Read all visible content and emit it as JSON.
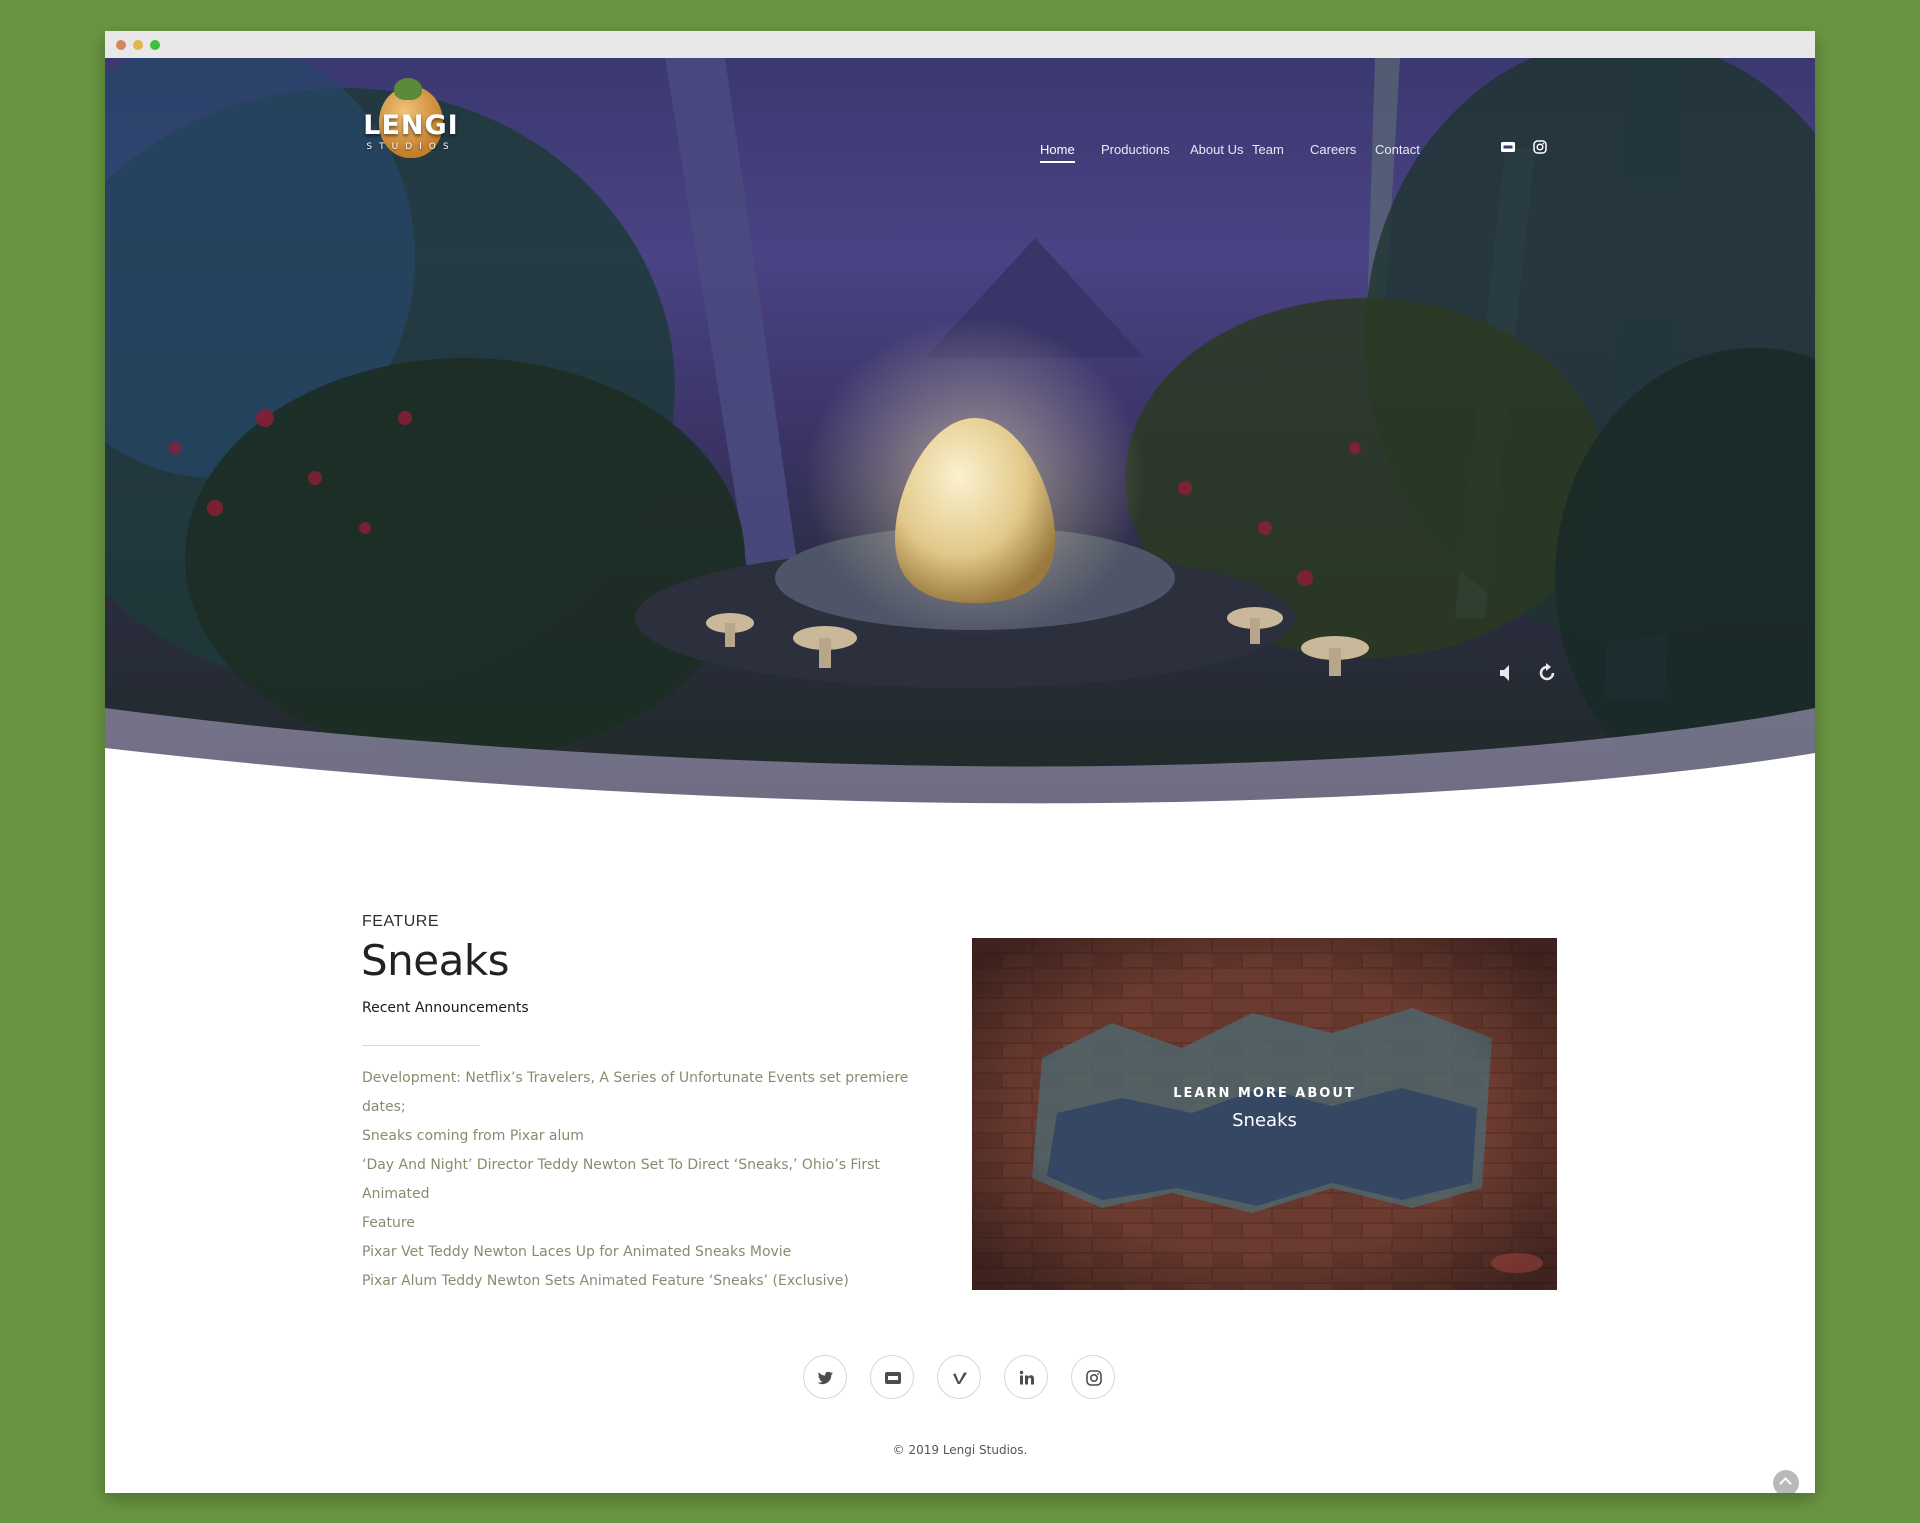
{
  "site": {
    "logo_text": "LENGI",
    "logo_subtext": "STUDIOS"
  },
  "nav": {
    "items": [
      {
        "label": "Home",
        "active": true
      },
      {
        "label": "Productions",
        "active": false
      },
      {
        "label": "About Us",
        "active": false
      },
      {
        "label": "Team",
        "active": false
      },
      {
        "label": "Careers",
        "active": false
      },
      {
        "label": "Contact",
        "active": false
      }
    ],
    "icons": [
      "imdb-icon",
      "instagram-icon"
    ]
  },
  "hero": {
    "video_controls": [
      "mute-icon",
      "replay-icon"
    ]
  },
  "feature": {
    "label": "FEATURE",
    "title": "Sneaks",
    "subtitle": "Recent Announcements",
    "announcements": [
      "Development: Netflix’s Travelers, A Series of Unfortunate Events set premiere dates;",
      "Sneaks coming from Pixar alum",
      "‘Day And Night’ Director Teddy Newton Set To Direct ‘Sneaks,’ Ohio’s First Animated",
      "Feature",
      "Pixar Vet Teddy Newton Laces Up for Animated Sneaks Movie",
      "Pixar Alum Teddy Newton Sets Animated Feature ‘Sneaks’ (Exclusive)"
    ],
    "card": {
      "kicker": "LEARN MORE ABOUT",
      "name": "Sneaks"
    }
  },
  "footer": {
    "social": [
      "twitter-icon",
      "imdb-icon",
      "vimeo-icon",
      "linkedin-icon",
      "instagram-icon"
    ],
    "copyright": "© 2019 Lengi Studios."
  },
  "colors": {
    "page_background": "#6a9642",
    "hero_sky": "#4a4384",
    "announcement_text": "#8b8a70",
    "title_text": "#222222"
  }
}
